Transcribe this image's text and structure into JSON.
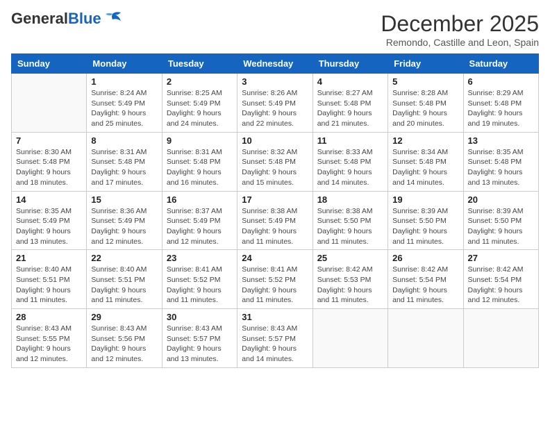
{
  "header": {
    "logo_general": "General",
    "logo_blue": "Blue",
    "month_title": "December 2025",
    "location": "Remondo, Castille and Leon, Spain"
  },
  "days_of_week": [
    "Sunday",
    "Monday",
    "Tuesday",
    "Wednesday",
    "Thursday",
    "Friday",
    "Saturday"
  ],
  "weeks": [
    [
      {
        "day": "",
        "info": ""
      },
      {
        "day": "1",
        "info": "Sunrise: 8:24 AM\nSunset: 5:49 PM\nDaylight: 9 hours\nand 25 minutes."
      },
      {
        "day": "2",
        "info": "Sunrise: 8:25 AM\nSunset: 5:49 PM\nDaylight: 9 hours\nand 24 minutes."
      },
      {
        "day": "3",
        "info": "Sunrise: 8:26 AM\nSunset: 5:49 PM\nDaylight: 9 hours\nand 22 minutes."
      },
      {
        "day": "4",
        "info": "Sunrise: 8:27 AM\nSunset: 5:48 PM\nDaylight: 9 hours\nand 21 minutes."
      },
      {
        "day": "5",
        "info": "Sunrise: 8:28 AM\nSunset: 5:48 PM\nDaylight: 9 hours\nand 20 minutes."
      },
      {
        "day": "6",
        "info": "Sunrise: 8:29 AM\nSunset: 5:48 PM\nDaylight: 9 hours\nand 19 minutes."
      }
    ],
    [
      {
        "day": "7",
        "info": "Sunrise: 8:30 AM\nSunset: 5:48 PM\nDaylight: 9 hours\nand 18 minutes."
      },
      {
        "day": "8",
        "info": "Sunrise: 8:31 AM\nSunset: 5:48 PM\nDaylight: 9 hours\nand 17 minutes."
      },
      {
        "day": "9",
        "info": "Sunrise: 8:31 AM\nSunset: 5:48 PM\nDaylight: 9 hours\nand 16 minutes."
      },
      {
        "day": "10",
        "info": "Sunrise: 8:32 AM\nSunset: 5:48 PM\nDaylight: 9 hours\nand 15 minutes."
      },
      {
        "day": "11",
        "info": "Sunrise: 8:33 AM\nSunset: 5:48 PM\nDaylight: 9 hours\nand 14 minutes."
      },
      {
        "day": "12",
        "info": "Sunrise: 8:34 AM\nSunset: 5:48 PM\nDaylight: 9 hours\nand 14 minutes."
      },
      {
        "day": "13",
        "info": "Sunrise: 8:35 AM\nSunset: 5:48 PM\nDaylight: 9 hours\nand 13 minutes."
      }
    ],
    [
      {
        "day": "14",
        "info": "Sunrise: 8:35 AM\nSunset: 5:49 PM\nDaylight: 9 hours\nand 13 minutes."
      },
      {
        "day": "15",
        "info": "Sunrise: 8:36 AM\nSunset: 5:49 PM\nDaylight: 9 hours\nand 12 minutes."
      },
      {
        "day": "16",
        "info": "Sunrise: 8:37 AM\nSunset: 5:49 PM\nDaylight: 9 hours\nand 12 minutes."
      },
      {
        "day": "17",
        "info": "Sunrise: 8:38 AM\nSunset: 5:49 PM\nDaylight: 9 hours\nand 11 minutes."
      },
      {
        "day": "18",
        "info": "Sunrise: 8:38 AM\nSunset: 5:50 PM\nDaylight: 9 hours\nand 11 minutes."
      },
      {
        "day": "19",
        "info": "Sunrise: 8:39 AM\nSunset: 5:50 PM\nDaylight: 9 hours\nand 11 minutes."
      },
      {
        "day": "20",
        "info": "Sunrise: 8:39 AM\nSunset: 5:50 PM\nDaylight: 9 hours\nand 11 minutes."
      }
    ],
    [
      {
        "day": "21",
        "info": "Sunrise: 8:40 AM\nSunset: 5:51 PM\nDaylight: 9 hours\nand 11 minutes."
      },
      {
        "day": "22",
        "info": "Sunrise: 8:40 AM\nSunset: 5:51 PM\nDaylight: 9 hours\nand 11 minutes."
      },
      {
        "day": "23",
        "info": "Sunrise: 8:41 AM\nSunset: 5:52 PM\nDaylight: 9 hours\nand 11 minutes."
      },
      {
        "day": "24",
        "info": "Sunrise: 8:41 AM\nSunset: 5:52 PM\nDaylight: 9 hours\nand 11 minutes."
      },
      {
        "day": "25",
        "info": "Sunrise: 8:42 AM\nSunset: 5:53 PM\nDaylight: 9 hours\nand 11 minutes."
      },
      {
        "day": "26",
        "info": "Sunrise: 8:42 AM\nSunset: 5:54 PM\nDaylight: 9 hours\nand 11 minutes."
      },
      {
        "day": "27",
        "info": "Sunrise: 8:42 AM\nSunset: 5:54 PM\nDaylight: 9 hours\nand 12 minutes."
      }
    ],
    [
      {
        "day": "28",
        "info": "Sunrise: 8:43 AM\nSunset: 5:55 PM\nDaylight: 9 hours\nand 12 minutes."
      },
      {
        "day": "29",
        "info": "Sunrise: 8:43 AM\nSunset: 5:56 PM\nDaylight: 9 hours\nand 12 minutes."
      },
      {
        "day": "30",
        "info": "Sunrise: 8:43 AM\nSunset: 5:57 PM\nDaylight: 9 hours\nand 13 minutes."
      },
      {
        "day": "31",
        "info": "Sunrise: 8:43 AM\nSunset: 5:57 PM\nDaylight: 9 hours\nand 14 minutes."
      },
      {
        "day": "",
        "info": ""
      },
      {
        "day": "",
        "info": ""
      },
      {
        "day": "",
        "info": ""
      }
    ]
  ]
}
